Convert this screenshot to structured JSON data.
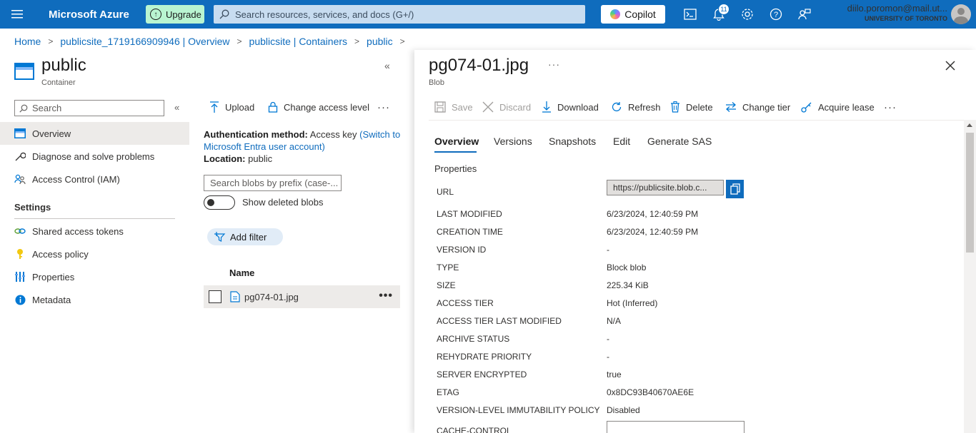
{
  "topbar": {
    "brand": "Microsoft Azure",
    "upgrade_label": "Upgrade",
    "search_placeholder": "Search resources, services, and docs (G+/)",
    "copilot_label": "Copilot",
    "notifications_count": "11",
    "user_email": "diilo.poromon@mail.ut...",
    "user_org": "UNIVERSITY OF TORONTO",
    "icons": [
      "menu-icon",
      "upgrade-icon",
      "search-icon",
      "copilot-icon",
      "cloud-shell-icon",
      "notifications-icon",
      "settings-icon",
      "help-icon",
      "feedback-icon",
      "avatar"
    ]
  },
  "breadcrumb": [
    "Home",
    "publicsite_1719166909946 | Overview",
    "publicsite | Containers",
    "public"
  ],
  "left": {
    "title": "public",
    "subtitle": "Container",
    "search_placeholder": "Search",
    "nav": [
      {
        "label": "Overview",
        "icon": "container-icon",
        "active": true
      },
      {
        "label": "Diagnose and solve problems",
        "icon": "wrench-icon"
      },
      {
        "label": "Access Control (IAM)",
        "icon": "people-icon"
      }
    ],
    "settings_header": "Settings",
    "settings": [
      {
        "label": "Shared access tokens",
        "icon": "link-icon"
      },
      {
        "label": "Access policy",
        "icon": "key-icon"
      },
      {
        "label": "Properties",
        "icon": "bars-icon"
      },
      {
        "label": "Metadata",
        "icon": "info-icon"
      }
    ]
  },
  "content": {
    "toolbar": {
      "upload": "Upload",
      "change_access": "Change access level",
      "more": "···"
    },
    "auth_label": "Authentication method:",
    "auth_value": "Access key",
    "auth_link": "(Switch to Microsoft Entra user account)",
    "location_label": "Location:",
    "location_value": "public",
    "blob_search_placeholder": "Search blobs by prefix (case-...",
    "show_deleted": "Show deleted blobs",
    "add_filter": "Add filter",
    "col_name": "Name",
    "blob_name": "pg074-01.jpg",
    "row_more": "•••"
  },
  "right": {
    "title": "pg074-01.jpg",
    "subtitle": "Blob",
    "title_more": "···",
    "toolbar": {
      "save": "Save",
      "discard": "Discard",
      "download": "Download",
      "refresh": "Refresh",
      "delete": "Delete",
      "change_tier": "Change tier",
      "acquire_lease": "Acquire lease",
      "more": "···"
    },
    "tabs": [
      "Overview",
      "Versions",
      "Snapshots",
      "Edit",
      "Generate SAS"
    ],
    "properties_title": "Properties",
    "url_label": "URL",
    "url_value": "https://publicsite.blob.c...",
    "properties": [
      {
        "key": "LAST MODIFIED",
        "value": "6/23/2024, 12:40:59 PM"
      },
      {
        "key": "CREATION TIME",
        "value": "6/23/2024, 12:40:59 PM"
      },
      {
        "key": "VERSION ID",
        "value": "-"
      },
      {
        "key": "TYPE",
        "value": "Block blob"
      },
      {
        "key": "SIZE",
        "value": "225.34 KiB"
      },
      {
        "key": "ACCESS TIER",
        "value": "Hot (Inferred)"
      },
      {
        "key": "ACCESS TIER LAST MODIFIED",
        "value": "N/A"
      },
      {
        "key": "ARCHIVE STATUS",
        "value": "-"
      },
      {
        "key": "REHYDRATE PRIORITY",
        "value": "-"
      },
      {
        "key": "SERVER ENCRYPTED",
        "value": "true"
      },
      {
        "key": "ETAG",
        "value": "0x8DC93B40670AE6E"
      },
      {
        "key": "VERSION-LEVEL IMMUTABILITY POLICY",
        "value": "Disabled"
      }
    ],
    "cache_control_label": "CACHE-CONTROL"
  },
  "colors": {
    "azure_blue": "#0f6cbd",
    "upgrade_green": "#b9f5d1",
    "nav_active": "#edebe9"
  }
}
